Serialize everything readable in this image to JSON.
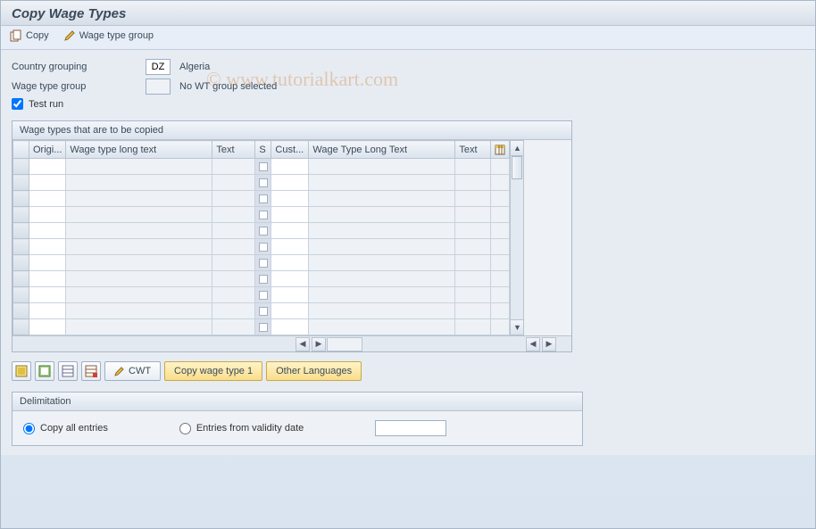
{
  "title": "Copy Wage Types",
  "toolbar": {
    "copy_label": "Copy",
    "wage_type_group_label": "Wage type group"
  },
  "fields": {
    "country_grouping_label": "Country grouping",
    "country_grouping_value": "DZ",
    "country_grouping_text": "Algeria",
    "wage_type_group_label": "Wage type group",
    "wage_type_group_value": "",
    "wage_type_group_text": "No WT group selected",
    "test_run_label": "Test run",
    "test_run_checked": true
  },
  "table": {
    "caption": "Wage types that are to be copied",
    "columns": [
      "Origi...",
      "Wage type long text",
      "Text",
      "S",
      "Cust...",
      "Wage Type Long Text",
      "Text"
    ],
    "row_count": 11
  },
  "buttons": {
    "cwt": "CWT",
    "copy_wage_type_1": "Copy wage type 1",
    "other_languages": "Other Languages"
  },
  "delimitation": {
    "title": "Delimitation",
    "option_all": "Copy all entries",
    "option_from": "Entries from validity date",
    "selected": "all",
    "date_value": ""
  },
  "watermark": "© www.tutorialkart.com",
  "chart_data": null
}
